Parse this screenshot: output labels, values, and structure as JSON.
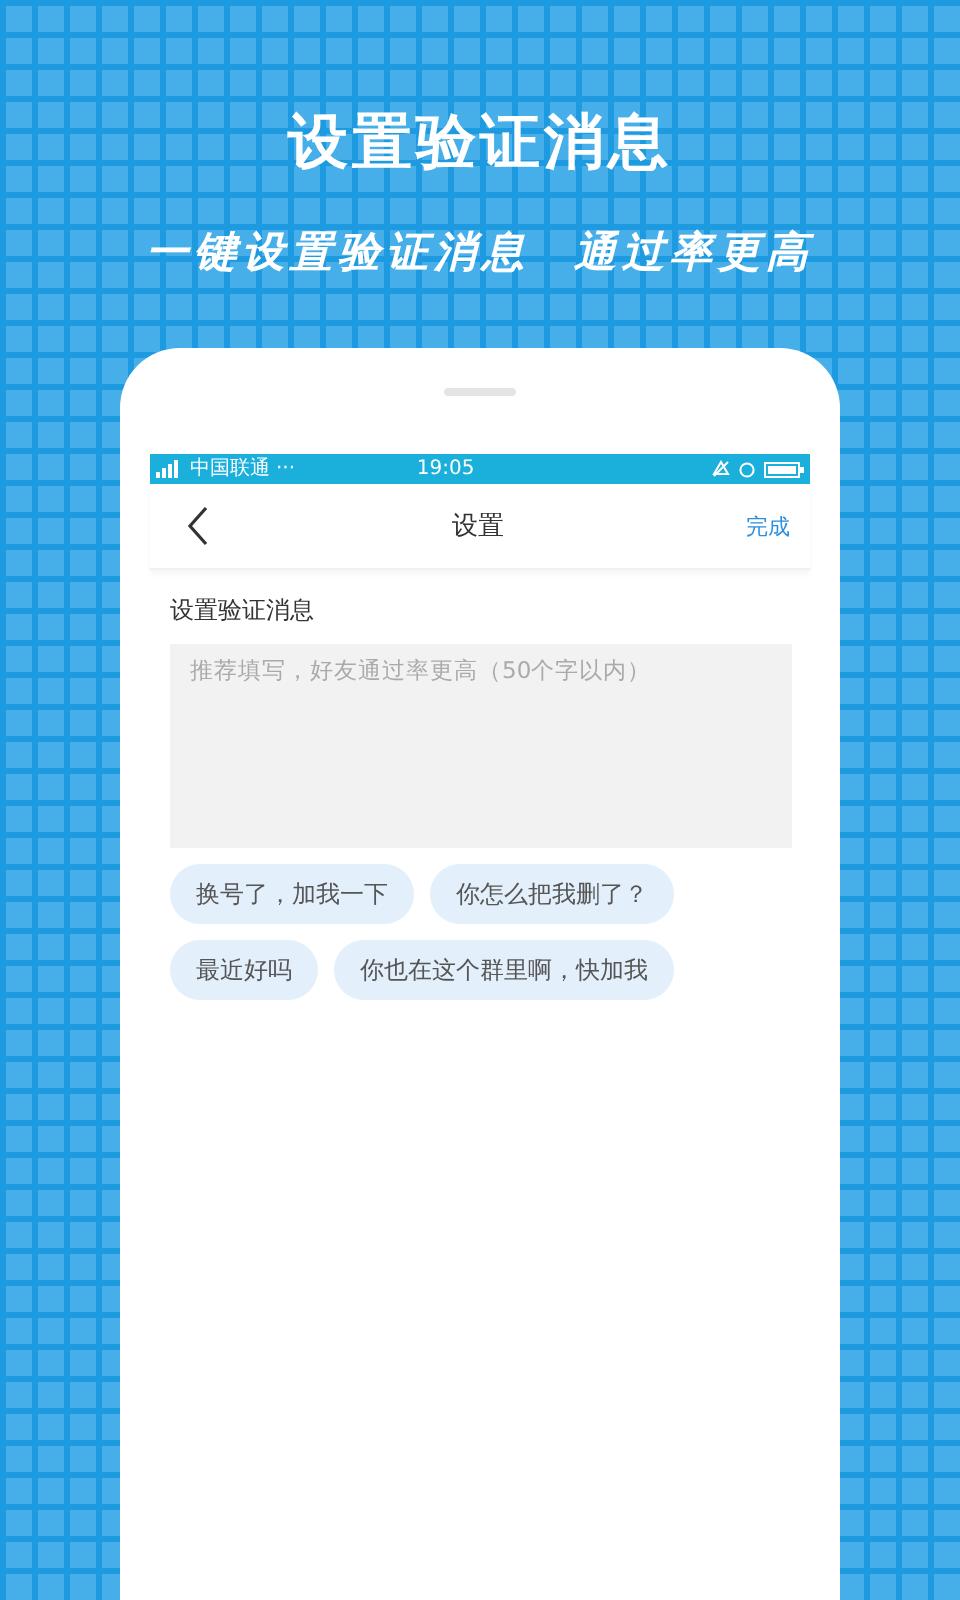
{
  "headline": "设置验证消息",
  "tagline": [
    "一键设置验证消息",
    "通过率更高"
  ],
  "status_bar": {
    "carrier": "中国联通",
    "more": "···",
    "time": "19:05"
  },
  "nav": {
    "title": "设置",
    "action": "完成"
  },
  "section_label": "设置验证消息",
  "message_field": {
    "placeholder": "推荐填写，好友通过率更高（50个字以内）"
  },
  "suggestions": [
    [
      "换号了，加我一下",
      "你怎么把我删了？"
    ],
    [
      "最近好吗",
      "你也在这个群里啊，快加我"
    ]
  ]
}
